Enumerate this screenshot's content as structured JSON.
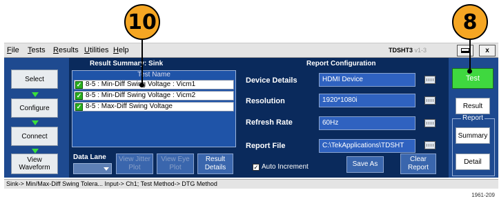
{
  "callouts": {
    "first": "10",
    "second": "8"
  },
  "menu": {
    "file": {
      "accel": "F",
      "rest": "ile"
    },
    "tests": {
      "accel": "T",
      "rest": "ests"
    },
    "results": {
      "accel": "R",
      "rest": "esults"
    },
    "utilities": {
      "accel": "U",
      "rest": "tilities"
    },
    "help": {
      "accel": "H",
      "rest": "elp"
    }
  },
  "app": {
    "name": "TDSHT3",
    "version": "v1-3"
  },
  "window_buttons": {
    "close": "x"
  },
  "left_buttons": [
    "Select",
    "Configure",
    "Connect",
    "View Waveform"
  ],
  "result_summary": {
    "title": "Result Summary: Sink",
    "column_header": "Test Name",
    "rows": [
      "8-5 : Min-Diff Swing Voltage : Vicm1",
      "8-5 : Min-Diff Swing Voltage : Vicm2",
      "8-5 : Max-Diff Swing Voltage"
    ],
    "data_lane_label": "Data Lane",
    "view_jitter_plot": "View Jitter Plot",
    "view_eye_plot": "View Eye Plot",
    "result_details": "Result Details"
  },
  "report_config": {
    "title": "Report Configuration",
    "device_details_label": "Device Details",
    "device_details_value": "HDMI Device",
    "resolution_label": "Resolution",
    "resolution_value": "1920*1080i",
    "refresh_rate_label": "Refresh Rate",
    "refresh_rate_value": "60Hz",
    "report_file_label": "Report File",
    "report_file_value": "C:\\TekApplications\\TDSHT",
    "auto_increment_label": "Auto Increment",
    "auto_increment_checked": true,
    "save_as": "Save As",
    "clear_report": "Clear Report"
  },
  "right_panel": {
    "test": "Test",
    "result": "Result",
    "report_group": "Report",
    "summary": "Summary",
    "detail": "Detail"
  },
  "status_text": "Sink-> Min/Max-Diff Swing Tolera... Input-> Ch1; Test Method-> DTG Method",
  "figure_id": "1961-209",
  "colors": {
    "panel_bg": "#0a2a5c",
    "side_bg": "#1e4a90",
    "test_green": "#3fd83f",
    "callout": "#f5a623"
  }
}
